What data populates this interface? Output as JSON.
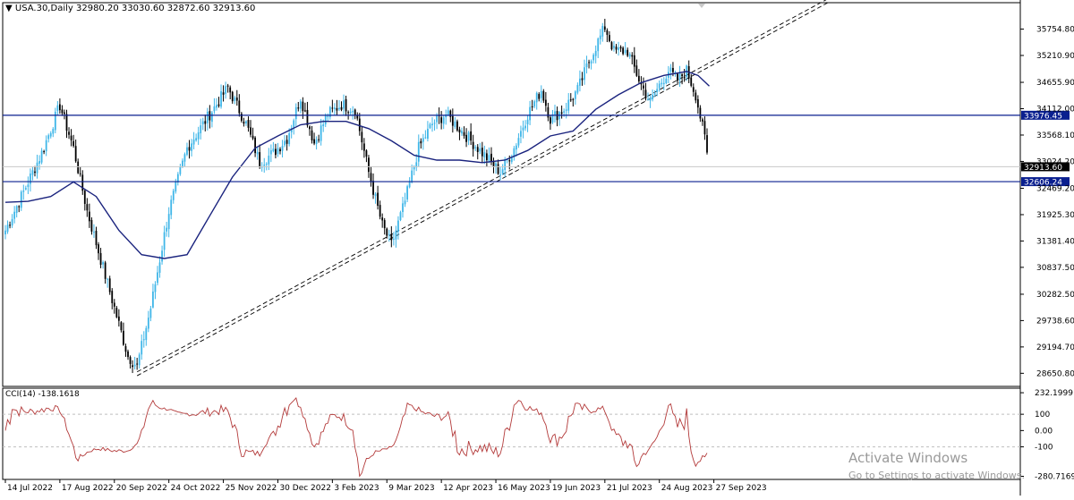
{
  "header": {
    "symbol": "USA.30,Daily",
    "ohlc": "32980.20 33030.60 32872.60 32913.60",
    "arrow": "▼"
  },
  "cci_header": "CCI(14) -138.1618",
  "watermark": {
    "line1": "Activate Windows",
    "line2": "Go to Settings to activate Windows."
  },
  "colors": {
    "bull": "#3fb6e8",
    "bear": "#000000",
    "ma": "#1a237e",
    "hline": "#0a1f8f",
    "cci": "#b33a3a",
    "grid": "#bfbfbf"
  },
  "chart_data": {
    "type": "candlestick",
    "price_axis": {
      "range": [
        28380,
        36300
      ],
      "ticks": [
        {
          "value": 35754.8,
          "label": "35754.80"
        },
        {
          "value": 35210.9,
          "label": "35210.90"
        },
        {
          "value": 34655.9,
          "label": "34655.90"
        },
        {
          "value": 34112.0,
          "label": "34112.00"
        },
        {
          "value": 33568.1,
          "label": "33568.10"
        },
        {
          "value": 33024.2,
          "label": "33024.20"
        },
        {
          "value": 32469.2,
          "label": "32469.20"
        },
        {
          "value": 31925.3,
          "label": "31925.30"
        },
        {
          "value": 31381.4,
          "label": "31381.40"
        },
        {
          "value": 30837.5,
          "label": "30837.50"
        },
        {
          "value": 30282.5,
          "label": "30282.50"
        },
        {
          "value": 29738.6,
          "label": "29738.60"
        },
        {
          "value": 29194.7,
          "label": "29194.70"
        },
        {
          "value": 28650.8,
          "label": "28650.80"
        }
      ]
    },
    "price_tags": [
      {
        "value": 33976.45,
        "label": "33976.45",
        "kind": "hline"
      },
      {
        "value": 32913.6,
        "label": "32913.60",
        "kind": "current"
      },
      {
        "value": 32606.24,
        "label": "32606.24",
        "kind": "hline"
      }
    ],
    "time_axis": {
      "bars": 310,
      "ticks": [
        {
          "bar": 0,
          "label": "14 Jul 2022"
        },
        {
          "bar": 24,
          "label": "17 Aug 2022"
        },
        {
          "bar": 48,
          "label": "20 Sep 2022"
        },
        {
          "bar": 72,
          "label": "24 Oct 2022"
        },
        {
          "bar": 96,
          "label": "25 Nov 2022"
        },
        {
          "bar": 120,
          "label": "30 Dec 2022"
        },
        {
          "bar": 144,
          "label": "3 Feb 2023"
        },
        {
          "bar": 168,
          "label": "9 Mar 2023"
        },
        {
          "bar": 192,
          "label": "12 Apr 2023"
        },
        {
          "bar": 216,
          "label": "16 May 2023"
        },
        {
          "bar": 240,
          "label": "19 Jun 2023"
        },
        {
          "bar": 264,
          "label": "21 Jul 2023"
        },
        {
          "bar": 288,
          "label": "24 Aug 2023"
        },
        {
          "bar": 312,
          "label": "27 Sep 2023"
        }
      ]
    },
    "close_path": [
      [
        0,
        31600
      ],
      [
        8,
        32400
      ],
      [
        16,
        33200
      ],
      [
        24,
        34180
      ],
      [
        30,
        33300
      ],
      [
        36,
        32000
      ],
      [
        42,
        31000
      ],
      [
        48,
        30000
      ],
      [
        54,
        29000
      ],
      [
        58,
        28800
      ],
      [
        64,
        30000
      ],
      [
        72,
        32000
      ],
      [
        80,
        33300
      ],
      [
        90,
        34000
      ],
      [
        98,
        34550
      ],
      [
        106,
        33800
      ],
      [
        112,
        33000
      ],
      [
        118,
        33200
      ],
      [
        124,
        33500
      ],
      [
        130,
        34350
      ],
      [
        136,
        33400
      ],
      [
        142,
        34000
      ],
      [
        148,
        34200
      ],
      [
        154,
        34100
      ],
      [
        160,
        32800
      ],
      [
        166,
        31700
      ],
      [
        170,
        31300
      ],
      [
        176,
        32200
      ],
      [
        182,
        33300
      ],
      [
        188,
        33800
      ],
      [
        194,
        34000
      ],
      [
        200,
        33700
      ],
      [
        206,
        33400
      ],
      [
        212,
        33100
      ],
      [
        218,
        32800
      ],
      [
        224,
        33300
      ],
      [
        230,
        34000
      ],
      [
        236,
        34500
      ],
      [
        240,
        33900
      ],
      [
        246,
        34100
      ],
      [
        252,
        34500
      ],
      [
        258,
        35200
      ],
      [
        264,
        35800
      ],
      [
        268,
        35300
      ],
      [
        274,
        35300
      ],
      [
        280,
        34600
      ],
      [
        284,
        34250
      ],
      [
        288,
        34600
      ],
      [
        292,
        34900
      ],
      [
        296,
        34700
      ],
      [
        300,
        34900
      ],
      [
        304,
        34400
      ],
      [
        308,
        33500
      ],
      [
        310,
        32913.6
      ]
    ],
    "moving_average": [
      [
        0,
        32180
      ],
      [
        10,
        32200
      ],
      [
        20,
        32300
      ],
      [
        30,
        32600
      ],
      [
        40,
        32300
      ],
      [
        50,
        31600
      ],
      [
        60,
        31100
      ],
      [
        70,
        31020
      ],
      [
        80,
        31100
      ],
      [
        90,
        31900
      ],
      [
        100,
        32700
      ],
      [
        110,
        33300
      ],
      [
        120,
        33550
      ],
      [
        130,
        33780
      ],
      [
        140,
        33850
      ],
      [
        150,
        33850
      ],
      [
        160,
        33700
      ],
      [
        170,
        33450
      ],
      [
        180,
        33150
      ],
      [
        190,
        33050
      ],
      [
        200,
        33050
      ],
      [
        210,
        33000
      ],
      [
        220,
        33050
      ],
      [
        230,
        33250
      ],
      [
        240,
        33550
      ],
      [
        250,
        33650
      ],
      [
        260,
        34100
      ],
      [
        270,
        34400
      ],
      [
        280,
        34650
      ],
      [
        290,
        34800
      ],
      [
        300,
        34880
      ],
      [
        305,
        34800
      ],
      [
        310,
        34580
      ]
    ],
    "trendlines": [
      {
        "from": [
          58,
          28600
        ],
        "to": [
          363,
          36320
        ]
      },
      {
        "from": [
          58,
          28680
        ],
        "to": [
          363,
          36400
        ]
      }
    ],
    "cci": {
      "name": "CCI(14)",
      "last": -138.1618,
      "range": [
        -300,
        260
      ],
      "ticks": [
        {
          "value": 232.1999,
          "label": "232.1999"
        },
        {
          "value": 100,
          "label": "100"
        },
        {
          "value": 0,
          "label": "0.00"
        },
        {
          "value": -100,
          "label": "-100"
        },
        {
          "value": -280.7169,
          "label": "-280.7169"
        }
      ],
      "levels": [
        100,
        -100
      ]
    }
  }
}
